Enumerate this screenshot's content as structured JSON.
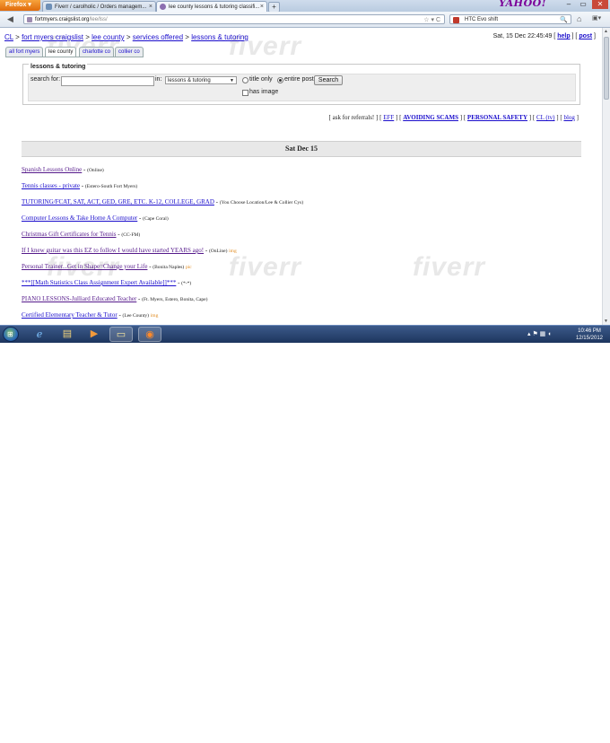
{
  "browser": {
    "menu_label": "Firefox ▾",
    "tabs": [
      {
        "title": "Fiverr / carolholic / Orders managem...",
        "close": "×"
      },
      {
        "title": "lee county lessons & tutoring classifi...",
        "close": "×"
      }
    ],
    "new_tab": "+",
    "search_provider_logo": "YAHOO!",
    "window_buttons": {
      "minimize": "–",
      "maximize": "▭",
      "close": "✕"
    },
    "nav_back": "◀",
    "url_host": "fortmyers.craigslist.org",
    "url_path": "/lee/lss/",
    "url_controls": "☆ ▾ C",
    "search_query": "HTC Evo shift",
    "search_icon": "🔍",
    "home_icon": "⌂",
    "bookmarks_icon": "▣▾"
  },
  "page": {
    "breadcrumb": [
      {
        "label": "CL",
        "link": true
      },
      {
        "label": ">",
        "link": false
      },
      {
        "label": "fort myers craigslist",
        "link": true
      },
      {
        "label": ">",
        "link": false
      },
      {
        "label": "lee county",
        "link": true
      },
      {
        "label": ">",
        "link": false
      },
      {
        "label": "services offered",
        "link": true
      },
      {
        "label": ">",
        "link": false
      },
      {
        "label": "lessons & tutoring",
        "link": true
      }
    ],
    "datetime": "Sat, 15 Dec 22:45:49",
    "help_label": "help",
    "post_label": "post",
    "subtabs": [
      {
        "label": "all fort myers",
        "current": false
      },
      {
        "label": "lee county",
        "current": true
      },
      {
        "label": "charlotte co",
        "current": false
      },
      {
        "label": "collier co",
        "current": false
      }
    ],
    "search": {
      "legend": "lessons & tutoring",
      "search_for_label": "search for:",
      "query": "",
      "in_label": "in:",
      "category": "lessons & tutoring",
      "title_only_label": "title only",
      "entire_post_label": "entire post",
      "has_image_label": "has image",
      "button_label": "Search"
    },
    "links_row": [
      {
        "prefix": "[ ",
        "label": "ask for referrals!",
        "link": false,
        "bold": false,
        "suffix": " ]"
      },
      {
        "prefix": " [ ",
        "label": "EFF",
        "link": true,
        "bold": false,
        "suffix": " ]"
      },
      {
        "prefix": " [ ",
        "label": "AVOIDING SCAMS",
        "link": true,
        "bold": true,
        "suffix": " ]"
      },
      {
        "prefix": " [ ",
        "label": "PERSONAL SAFETY",
        "link": true,
        "bold": true,
        "suffix": " ]"
      },
      {
        "prefix": " [ ",
        "label": "CL (tv)",
        "link": true,
        "bold": false,
        "suffix": " ]"
      },
      {
        "prefix": " [ ",
        "label": "blog",
        "link": true,
        "bold": false,
        "suffix": " ]"
      }
    ],
    "day_header": "Sat Dec 15",
    "listings": [
      {
        "title": "Spanish Lessons Online",
        "location": "(Online)",
        "tag": "",
        "visited": true
      },
      {
        "title": "Tennis classes - private",
        "location": "(Estero-South Fort Myers)",
        "tag": "",
        "visited": false
      },
      {
        "title": "TUTORING/FCAT, SAT, ACT, GED, GRE, ETC. K-12, COLLEGE, GRAD",
        "location": "(You Choose Location/Lee & Collier Cys)",
        "tag": "",
        "visited": false
      },
      {
        "title": "Computer Lessons & Take Home A Computer",
        "location": "(Cape Coral)",
        "tag": "",
        "visited": false
      },
      {
        "title": "Christmas Gift Certificates for Tennis",
        "location": "(CC-FM)",
        "tag": "",
        "visited": true
      },
      {
        "title": "If I knew guitar was this EZ to follow I would have started YEARS ago!",
        "location": "(OnLine)",
        "tag": "img",
        "visited": true
      },
      {
        "title": "Personal Trainer...Get in Shape=Change your Life",
        "location": "(Bonita Naples)",
        "tag": "pic",
        "visited": true
      },
      {
        "title": "***[[Math Statistics Class Assignment Expert Available]]***",
        "location": "(*-*)",
        "tag": "",
        "visited": false
      },
      {
        "title": "PIANO LESSONS-Julliard Educated Teacher",
        "location": "(Ft. Myers, Estero, Bonita, Cape)",
        "tag": "",
        "visited": true
      },
      {
        "title": "Certified Elementary Teacher & Tutor",
        "location": "(Lee County)",
        "tag": "img",
        "visited": false
      }
    ],
    "watermark": "fiverr"
  },
  "taskbar": {
    "start_glyph": "⊞",
    "apps": [
      {
        "name": "ie-icon",
        "glyph": "e"
      },
      {
        "name": "explorer-icon",
        "glyph": "▤"
      },
      {
        "name": "media-player-icon",
        "glyph": "▶"
      },
      {
        "name": "notes-icon",
        "glyph": "▭"
      },
      {
        "name": "firefox-icon",
        "glyph": "◉"
      }
    ],
    "tray_icons": "▴  ⚑  ▦  ◖",
    "time": "10:46 PM",
    "date": "12/15/2012"
  },
  "colors": {
    "link": "#1a0dcc",
    "visited": "#551a8b",
    "tag": "#e08a1e",
    "taskbar": "#1d355e",
    "firefox_button": "#e06b0b"
  }
}
